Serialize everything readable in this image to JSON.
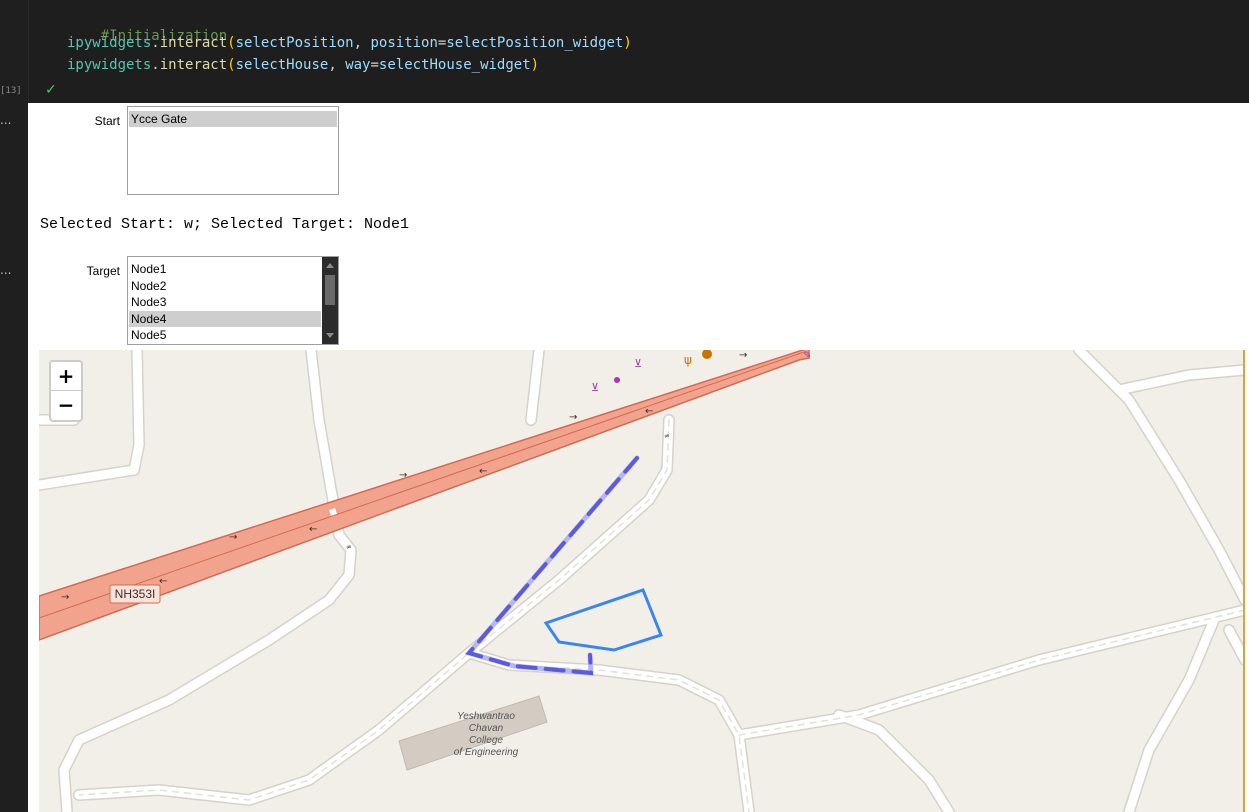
{
  "notebook": {
    "exec_count": "[13]",
    "out_dots": "...",
    "code": {
      "comment": "#Initialization",
      "line2": {
        "module": "ipywidgets",
        "dot": ".",
        "fn": "interact",
        "open": "(",
        "arg1": "selectPosition",
        "comma": ", ",
        "param": "position",
        "eq": "=",
        "arg2": "selectPosition_widget",
        "close": ")"
      },
      "line3": {
        "module": "ipywidgets",
        "dot": ".",
        "fn": "interact",
        "open": "(",
        "arg1": "selectHouse",
        "comma": ", ",
        "param": "way",
        "eq": "=",
        "arg2": "selectHouse_widget",
        "close": ")"
      }
    },
    "check": "✓"
  },
  "start_widget": {
    "label": "Start",
    "options": [
      "Ycce Gate"
    ],
    "selected_index": 0
  },
  "status": "Selected Start: w; Selected Target: Node1",
  "target_widget": {
    "label": "Target",
    "options": [
      "Node1",
      "Node2",
      "Node3",
      "Node4",
      "Node5"
    ],
    "selected_index": 3
  },
  "map": {
    "zoom_in": "+",
    "zoom_out": "−",
    "road_label": "NH353I",
    "place_label": [
      "Yeshwantrao",
      "Chavan",
      "College",
      "of Engineering"
    ],
    "colors": {
      "background": "#f2efe9",
      "trunk_road": "#f2a38e",
      "trunk_edge": "#d46a52",
      "minor_road": "#ffffff",
      "minor_road_edge": "#d6d2ca",
      "route": "#5b5bdc",
      "polygon": "#3a86f0",
      "building": "#d4ccc3"
    }
  }
}
